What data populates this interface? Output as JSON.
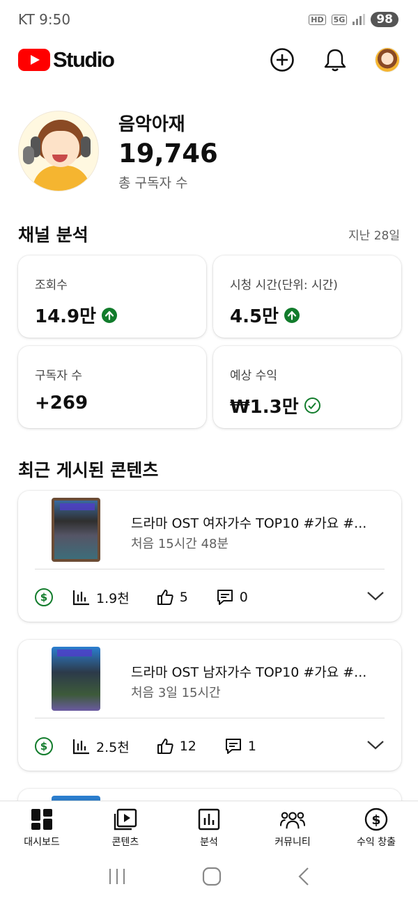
{
  "status_bar": {
    "carrier_time": "KT 9:50",
    "hd": "HD",
    "network": "5G",
    "battery": "98"
  },
  "header": {
    "logo_text": "Studio",
    "icons": [
      "create-icon",
      "bell-icon",
      "avatar"
    ]
  },
  "channel": {
    "name": "음악아재",
    "subscribers": "19,746",
    "subscribers_label": "총 구독자 수"
  },
  "analytics": {
    "title": "채널 분석",
    "period": "지난 28일",
    "metrics": [
      {
        "label": "조회수",
        "value": "14.9만",
        "indicator": "up-arrow-icon"
      },
      {
        "label": "시청 시간(단위: 시간)",
        "value": "4.5만",
        "indicator": "up-arrow-icon"
      },
      {
        "label": "구독자 수",
        "value": "+269",
        "indicator": ""
      },
      {
        "label": "예상 수익",
        "value": "₩1.3만",
        "indicator": "check-icon"
      }
    ]
  },
  "recent": {
    "title": "최근 게시된 콘텐츠",
    "videos": [
      {
        "title": "드라마 OST 여자가수 TOP10 #가요 #...",
        "meta": "처음 15시간 48분",
        "views": "1.9천",
        "likes": "5",
        "comments": "0"
      },
      {
        "title": "드라마 OST 남자가수 TOP10 #가요 #...",
        "meta": "처음 3일 15시간",
        "views": "2.5천",
        "likes": "12",
        "comments": "1"
      }
    ]
  },
  "bottom_nav": [
    {
      "label": "대시보드",
      "icon": "dashboard-icon"
    },
    {
      "label": "콘텐츠",
      "icon": "content-icon"
    },
    {
      "label": "분석",
      "icon": "analytics-icon"
    },
    {
      "label": "커뮤니티",
      "icon": "community-icon"
    },
    {
      "label": "수익 창출",
      "icon": "monetization-icon"
    }
  ],
  "colors": {
    "accent_red": "#ff0000",
    "positive_green": "#127c2c",
    "text_primary": "#0f0f0f",
    "text_secondary": "#606060"
  }
}
